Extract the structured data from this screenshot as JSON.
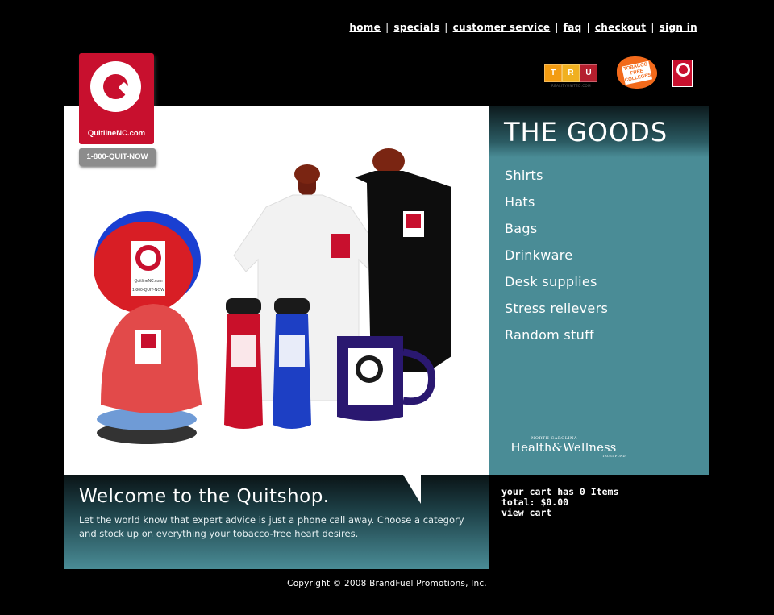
{
  "topnav": {
    "home": "home",
    "specials": "specials",
    "customer_service": "customer service",
    "faq": "faq",
    "checkout": "checkout",
    "sign_in": "sign in",
    "separator": "|"
  },
  "logo": {
    "brand": "QuitlineNC.com",
    "phone": "1-800-QUIT-NOW"
  },
  "badges": {
    "tru_letters": [
      "T",
      "R",
      "U"
    ],
    "tru_sub": "REALITYUNITED.COM",
    "tobacco_free": "TOBACCO FREE COLLEGES"
  },
  "colors": {
    "accent_teal": "#4a8c96",
    "brand_red": "#c8102e",
    "background": "#000000"
  },
  "sidebar": {
    "title": "THE GOODS",
    "items": [
      {
        "label": "Shirts"
      },
      {
        "label": "Hats"
      },
      {
        "label": "Bags"
      },
      {
        "label": "Drinkware"
      },
      {
        "label": "Desk supplies"
      },
      {
        "label": "Stress relievers"
      },
      {
        "label": "Random stuff"
      }
    ],
    "partner": {
      "small": "NORTH CAROLINA",
      "main": "Health&Wellness",
      "trust": "TRUST FUND"
    }
  },
  "welcome": {
    "title": "Welcome to the Quitshop.",
    "body": "Let the world know that expert advice is just a phone call away. Choose a category and stock up on everything your tobacco-free heart desires."
  },
  "cart": {
    "summary": "your cart has 0 Items",
    "total": "total: $0.00",
    "view_link": "view cart"
  },
  "footer": {
    "copyright": "Copyright © 2008 BrandFuel Promotions, Inc."
  },
  "product_labels": {
    "brand": "QuitlineNC.com",
    "phone": "1-800-QUIT-NOW"
  }
}
